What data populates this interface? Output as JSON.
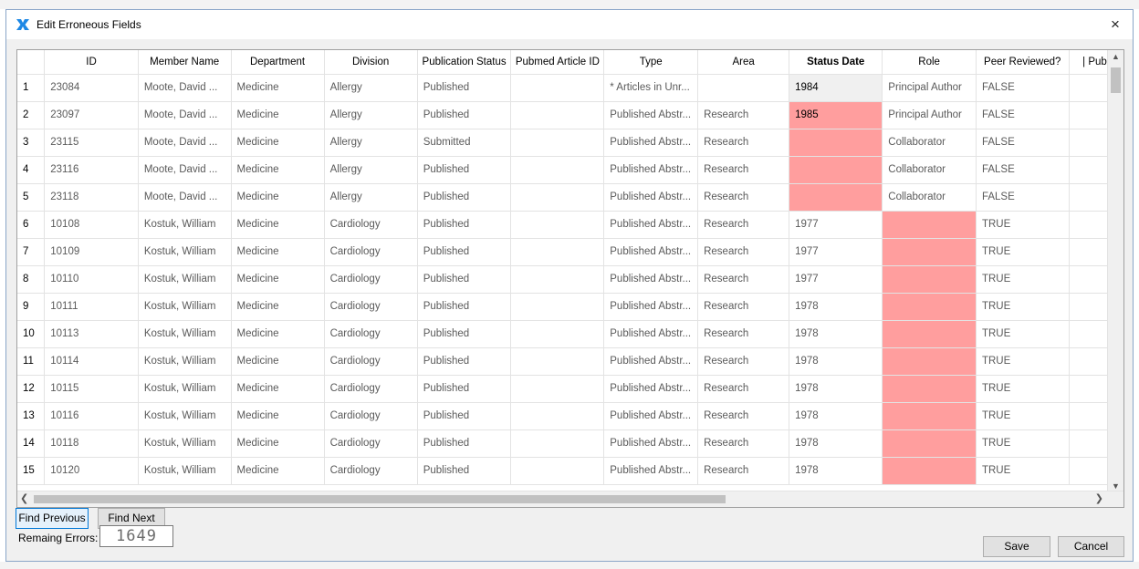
{
  "window": {
    "title": "Edit Erroneous Fields",
    "close_glyph": "×",
    "icon": "x-logo-icon",
    "accent": "#1e88e5"
  },
  "grid": {
    "columns": [
      "",
      "ID",
      "Member Name",
      "Department",
      "Division",
      "Publication Status",
      "Pubmed Article ID",
      "Type",
      "Area",
      "Status Date",
      "Role",
      "Peer Reviewed?",
      "| Publ"
    ],
    "rows": [
      [
        "1",
        "23084",
        "Moote, David ...",
        "Medicine",
        "Allergy",
        "Published",
        "",
        "* Articles in Unr...",
        "",
        "1984",
        "Principal Author",
        "FALSE",
        ""
      ],
      [
        "2",
        "23097",
        "Moote, David ...",
        "Medicine",
        "Allergy",
        "Published",
        "",
        "Published Abstr...",
        "Research",
        "1985",
        "Principal Author",
        "FALSE",
        ""
      ],
      [
        "3",
        "23115",
        "Moote, David ...",
        "Medicine",
        "Allergy",
        "Submitted",
        "",
        "Published Abstr...",
        "Research",
        "",
        "Collaborator",
        "FALSE",
        ""
      ],
      [
        "4",
        "23116",
        "Moote, David ...",
        "Medicine",
        "Allergy",
        "Published",
        "",
        "Published Abstr...",
        "Research",
        "",
        "Collaborator",
        "FALSE",
        ""
      ],
      [
        "5",
        "23118",
        "Moote, David ...",
        "Medicine",
        "Allergy",
        "Published",
        "",
        "Published Abstr...",
        "Research",
        "",
        "Collaborator",
        "FALSE",
        ""
      ],
      [
        "6",
        "10108",
        "Kostuk, William",
        "Medicine",
        "Cardiology",
        "Published",
        "",
        "Published Abstr...",
        "Research",
        "1977",
        "",
        "TRUE",
        ""
      ],
      [
        "7",
        "10109",
        "Kostuk, William",
        "Medicine",
        "Cardiology",
        "Published",
        "",
        "Published Abstr...",
        "Research",
        "1977",
        "",
        "TRUE",
        ""
      ],
      [
        "8",
        "10110",
        "Kostuk, William",
        "Medicine",
        "Cardiology",
        "Published",
        "",
        "Published Abstr...",
        "Research",
        "1977",
        "",
        "TRUE",
        ""
      ],
      [
        "9",
        "10111",
        "Kostuk, William",
        "Medicine",
        "Cardiology",
        "Published",
        "",
        "Published Abstr...",
        "Research",
        "1978",
        "",
        "TRUE",
        ""
      ],
      [
        "10",
        "10113",
        "Kostuk, William",
        "Medicine",
        "Cardiology",
        "Published",
        "",
        "Published Abstr...",
        "Research",
        "1978",
        "",
        "TRUE",
        ""
      ],
      [
        "11",
        "10114",
        "Kostuk, William",
        "Medicine",
        "Cardiology",
        "Published",
        "",
        "Published Abstr...",
        "Research",
        "1978",
        "",
        "TRUE",
        ""
      ],
      [
        "12",
        "10115",
        "Kostuk, William",
        "Medicine",
        "Cardiology",
        "Published",
        "",
        "Published Abstr...",
        "Research",
        "1978",
        "",
        "TRUE",
        ""
      ],
      [
        "13",
        "10116",
        "Kostuk, William",
        "Medicine",
        "Cardiology",
        "Published",
        "",
        "Published Abstr...",
        "Research",
        "1978",
        "",
        "TRUE",
        ""
      ],
      [
        "14",
        "10118",
        "Kostuk, William",
        "Medicine",
        "Cardiology",
        "Published",
        "",
        "Published Abstr...",
        "Research",
        "1978",
        "",
        "TRUE",
        ""
      ],
      [
        "15",
        "10120",
        "Kostuk, William",
        "Medicine",
        "Cardiology",
        "Published",
        "",
        "Published Abstr...",
        "Research",
        "1978",
        "",
        "TRUE",
        ""
      ]
    ],
    "error_color": "#ff9e9e",
    "highlight_color": "#f0f0f0"
  },
  "buttons": {
    "find_previous": "Find Previous",
    "find_next": "Find Next",
    "save": "Save",
    "cancel": "Cancel"
  },
  "status": {
    "remaining_label": "Remaing Errors:",
    "remaining_count": "1649"
  }
}
